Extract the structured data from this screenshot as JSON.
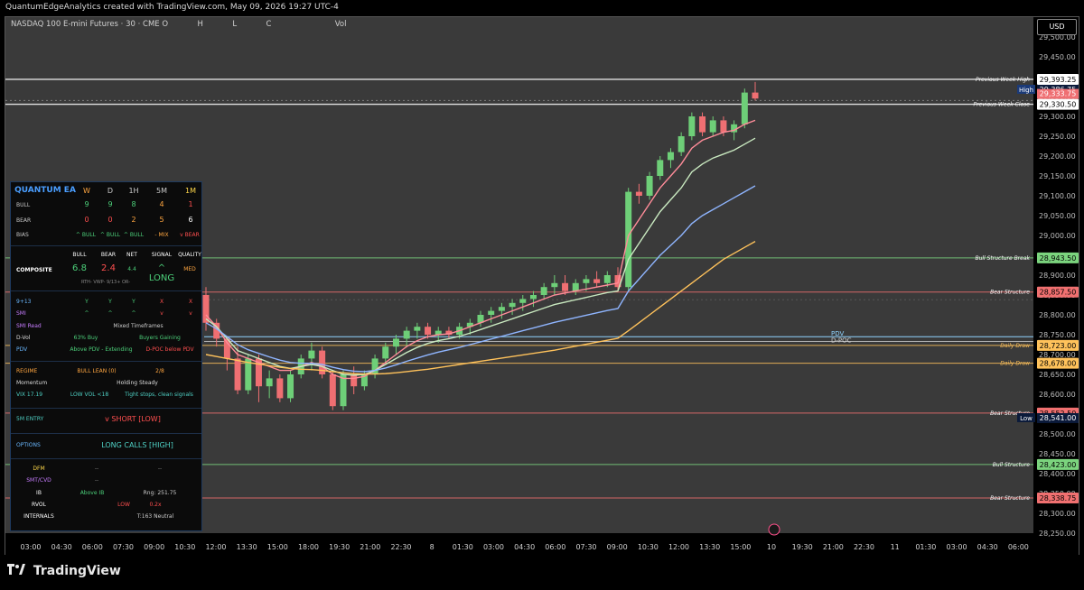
{
  "header_text": "QuantumEdgeAnalytics created with TradingView.com, May 09, 2026 19:27 UTC-4",
  "legend": {
    "symbol": "NASDAQ 100 E-mini Futures · 30 · CME",
    "o_label": "O",
    "h_label": "H",
    "l_label": "L",
    "c_label": "C",
    "vol_label": "Vol"
  },
  "currency": "USD",
  "brand": "TradingView",
  "colors": {
    "bull": "#6ecf78",
    "bear": "#ef6f72",
    "bg": "#3a3a3a",
    "ema_fast": "#ff8c99",
    "ema_mid": "#c9e9c0",
    "ema_slow": "#8fb5ff",
    "ema_long": "#ffc25b"
  },
  "price_axis": [
    "29,500.00",
    "29,450.00",
    "29,400.00",
    "29,350.00",
    "29,300.00",
    "29,250.00",
    "29,200.00",
    "29,150.00",
    "29,100.00",
    "29,050.00",
    "29,000.00",
    "28,950.00",
    "28,900.00",
    "28,850.00",
    "28,800.00",
    "28,750.00",
    "28,700.00",
    "28,650.00",
    "28,600.00",
    "28,550.00",
    "28,500.00",
    "28,450.00",
    "28,400.00",
    "28,350.00",
    "28,300.00",
    "28,250.00"
  ],
  "time_axis": [
    "03:00",
    "04:30",
    "06:00",
    "07:30",
    "09:00",
    "10:30",
    "12:00",
    "13:30",
    "15:00",
    "18:00",
    "19:30",
    "21:00",
    "22:30",
    "8",
    "01:30",
    "03:00",
    "04:30",
    "06:00",
    "07:30",
    "09:00",
    "10:30",
    "12:00",
    "13:30",
    "15:00",
    "10",
    "19:30",
    "21:00",
    "22:30",
    "11",
    "01:30",
    "03:00",
    "04:30",
    "06:00"
  ],
  "levels": [
    {
      "label": "Previous Week High",
      "price": 29393.25,
      "tag": "29,393.25",
      "tag2": "29,386.75",
      "tag2_label": "High",
      "color": "#ffffff"
    },
    {
      "label": "Previous Week Close",
      "price": 29330.5,
      "tag": "29,330.50",
      "tag2": "29,333.75",
      "color": "#ffffff"
    },
    {
      "label": "Bull Structure Break",
      "price": 28943.5,
      "tag": "28,943.50",
      "color": "#7bd47e"
    },
    {
      "label": "Bear Structure",
      "price": 28857.5,
      "tag": "28,857.50",
      "color": "#f07070"
    },
    {
      "label": "Daily Draw",
      "price": 28723.0,
      "tag": "28,723.00",
      "color": "#ffc25b"
    },
    {
      "label": "Daily Draw",
      "price": 28678.0,
      "tag": "28,678.00",
      "color": "#ffc25b"
    },
    {
      "label": "Bear Structure",
      "price": 28552.5,
      "tag": "28,552.50",
      "color": "#f07070"
    },
    {
      "label": "Bull Structure",
      "price": 28423.0,
      "tag": "28,423.00",
      "color": "#7bd47e"
    },
    {
      "label": "Bear Structure",
      "price": 28338.75,
      "tag": "28,338.75",
      "color": "#f07070"
    }
  ],
  "low_tag": {
    "label": "Low",
    "value": "28,541.00"
  },
  "pdv_label": "PDV",
  "dpoc_label": "D-POC",
  "panel": {
    "title": "QUANTUM EA",
    "tf_headers": [
      "W",
      "D",
      "1H",
      "5M",
      "1M"
    ],
    "bull_label": "BULL",
    "bull_values": [
      "9",
      "9",
      "8",
      "4",
      "1"
    ],
    "bear_label": "BEAR",
    "bear_values": [
      "0",
      "0",
      "2",
      "5",
      "6"
    ],
    "bias_label": "BIAS",
    "bias_values": [
      "^ BULL",
      "^ BULL",
      "^ BULL",
      "- MIX",
      "v BEAR"
    ],
    "comp_headers": [
      "BULL",
      "BEAR",
      "NET",
      "SIGNAL",
      "QUALITY"
    ],
    "composite_label": "COMPOSITE",
    "composite_values": [
      "6.8",
      "2.4",
      "4.4",
      "^ LONG",
      "MED"
    ],
    "composite_sub": "RTH- VWP- 9/13+ OR-",
    "ema_label": "9+13",
    "ema_values": [
      "Y",
      "Y",
      "Y",
      "X",
      "X"
    ],
    "smi_label": "SMI",
    "smi_values": [
      "^",
      "^",
      "^",
      "v",
      "v"
    ],
    "smi_read_label": "SMI Read",
    "smi_read_value": "Mixed Timeframes",
    "dvol_label": "D-Vol",
    "dvol_value1": "63% Buy",
    "dvol_value2": "Buyers Gaining",
    "pdv_row_label": "PDV",
    "pdv_value1": "Above PDV - Extending",
    "pdv_value2": "D-POC below PDV",
    "regime_label": "REGIME",
    "regime_value": "BULL LEAN  (0)",
    "regime_score": "2/8",
    "momentum_label": "Momentum",
    "momentum_value": "Holding Steady",
    "vix_label": "VIX 17.19",
    "vix_value1": "LOW VOL  <18",
    "vix_value2": "Tight stops, clean signals",
    "entry_label": "5M ENTRY",
    "entry_value": "v SHORT [LOW]",
    "options_label": "OPTIONS",
    "options_value": "LONG CALLS [HIGH]",
    "dfm_label": "DFM",
    "dfm_value1": "--",
    "dfm_value2": "--",
    "smt_label": "SMT/CVD",
    "smt_value": "--",
    "ib_label": "IB",
    "ib_value": "Above IB",
    "ib_rng": "Rng: 251.75",
    "rvol_label": "RVOL",
    "rvol_value1": "LOW",
    "rvol_value2": "0.2x",
    "internals_label": "INTERNALS",
    "internals_value": "T:163 Neutral"
  },
  "chart_data": {
    "type": "candlestick",
    "ylim": [
      28250,
      29550
    ],
    "candles": [
      [
        28850,
        28870,
        28760,
        28780
      ],
      [
        28780,
        28790,
        28720,
        28740
      ],
      [
        28740,
        28745,
        28660,
        28690
      ],
      [
        28690,
        28720,
        28600,
        28610
      ],
      [
        28610,
        28700,
        28600,
        28690
      ],
      [
        28690,
        28700,
        28580,
        28620
      ],
      [
        28620,
        28660,
        28590,
        28640
      ],
      [
        28640,
        28650,
        28580,
        28590
      ],
      [
        28590,
        28660,
        28580,
        28650
      ],
      [
        28650,
        28700,
        28640,
        28690
      ],
      [
        28690,
        28730,
        28660,
        28710
      ],
      [
        28710,
        28720,
        28640,
        28650
      ],
      [
        28650,
        28660,
        28560,
        28570
      ],
      [
        28570,
        28660,
        28560,
        28650
      ],
      [
        28650,
        28670,
        28600,
        28620
      ],
      [
        28620,
        28660,
        28610,
        28650
      ],
      [
        28650,
        28700,
        28640,
        28690
      ],
      [
        28690,
        28730,
        28680,
        28720
      ],
      [
        28720,
        28750,
        28700,
        28740
      ],
      [
        28740,
        28770,
        28720,
        28760
      ],
      [
        28760,
        28780,
        28740,
        28770
      ],
      [
        28770,
        28780,
        28740,
        28750
      ],
      [
        28750,
        28770,
        28730,
        28760
      ],
      [
        28760,
        28770,
        28740,
        28750
      ],
      [
        28750,
        28780,
        28740,
        28770
      ],
      [
        28770,
        28790,
        28750,
        28780
      ],
      [
        28780,
        28810,
        28770,
        28800
      ],
      [
        28800,
        28820,
        28780,
        28810
      ],
      [
        28810,
        28830,
        28790,
        28820
      ],
      [
        28820,
        28840,
        28800,
        28830
      ],
      [
        28830,
        28850,
        28810,
        28840
      ],
      [
        28840,
        28860,
        28820,
        28850
      ],
      [
        28850,
        28880,
        28840,
        28870
      ],
      [
        28870,
        28900,
        28850,
        28880
      ],
      [
        28880,
        28900,
        28850,
        28860
      ],
      [
        28860,
        28890,
        28850,
        28880
      ],
      [
        28880,
        28900,
        28860,
        28890
      ],
      [
        28890,
        28910,
        28870,
        28880
      ],
      [
        28880,
        28910,
        28870,
        28900
      ],
      [
        28900,
        28920,
        28860,
        28870
      ],
      [
        28870,
        29120,
        28860,
        29110
      ],
      [
        29110,
        29130,
        29080,
        29100
      ],
      [
        29100,
        29160,
        29090,
        29150
      ],
      [
        29150,
        29200,
        29140,
        29190
      ],
      [
        29190,
        29220,
        29170,
        29210
      ],
      [
        29210,
        29260,
        29200,
        29250
      ],
      [
        29250,
        29310,
        29240,
        29300
      ],
      [
        29300,
        29310,
        29250,
        29260
      ],
      [
        29260,
        29300,
        29250,
        29290
      ],
      [
        29290,
        29300,
        29250,
        29260
      ],
      [
        29260,
        29290,
        29240,
        29280
      ],
      [
        29280,
        29370,
        29270,
        29360
      ],
      [
        29360,
        29386.75,
        29340,
        29345
      ]
    ],
    "series": [
      {
        "name": "EMA fast",
        "values": [
          28800,
          28770,
          28730,
          28700,
          28690,
          28680,
          28670,
          28660,
          28660,
          28670,
          28680,
          28670,
          28650,
          28640,
          28640,
          28645,
          28660,
          28680,
          28700,
          28720,
          28735,
          28745,
          28750,
          28752,
          28760,
          28770,
          28780,
          28790,
          28800,
          28810,
          28820,
          28830,
          28840,
          28850,
          28855,
          28860,
          28865,
          28870,
          28875,
          28880,
          29000,
          29040,
          29080,
          29120,
          29150,
          29180,
          29220,
          29240,
          29250,
          29260,
          29265,
          29280,
          29290
        ]
      },
      {
        "name": "EMA mid",
        "values": [
          28790,
          28770,
          28740,
          28710,
          28700,
          28690,
          28680,
          28670,
          28665,
          28670,
          28675,
          28670,
          28660,
          28650,
          28648,
          28650,
          28660,
          28675,
          28690,
          28705,
          28718,
          28728,
          28735,
          28740,
          28746,
          28754,
          28763,
          28772,
          28781,
          28790,
          28799,
          28808,
          28817,
          28826,
          28832,
          28838,
          28844,
          28850,
          28856,
          28860,
          28940,
          28980,
          29020,
          29060,
          29090,
          29120,
          29160,
          29180,
          29195,
          29205,
          29215,
          29230,
          29245
        ]
      },
      {
        "name": "EMA slow",
        "values": [
          28780,
          28765,
          28745,
          28725,
          28712,
          28703,
          28694,
          28686,
          28680,
          28678,
          28678,
          28675,
          28668,
          28662,
          28658,
          28657,
          28660,
          28666,
          28674,
          28683,
          28691,
          28699,
          28706,
          28712,
          28718,
          28725,
          28732,
          28739,
          28746,
          28753,
          28760,
          28767,
          28774,
          28781,
          28787,
          28793,
          28799,
          28805,
          28811,
          28816,
          28860,
          28890,
          28920,
          28950,
          28975,
          29000,
          29030,
          29050,
          29065,
          29080,
          29095,
          29110,
          29125
        ]
      },
      {
        "name": "EMA long",
        "values": [
          28700,
          28695,
          28690,
          28685,
          28680,
          28676,
          28672,
          28668,
          28665,
          28663,
          28662,
          28660,
          28657,
          28654,
          28652,
          28651,
          28651,
          28652,
          28654,
          28657,
          28660,
          28663,
          28667,
          28671,
          28675,
          28679,
          28683,
          28687,
          28691,
          28695,
          28699,
          28703,
          28707,
          28711,
          28716,
          28721,
          28726,
          28731,
          28736,
          28741,
          28760,
          28780,
          28800,
          28820,
          28840,
          28860,
          28880,
          28900,
          28920,
          28940,
          28955,
          28970,
          28985
        ]
      }
    ]
  }
}
